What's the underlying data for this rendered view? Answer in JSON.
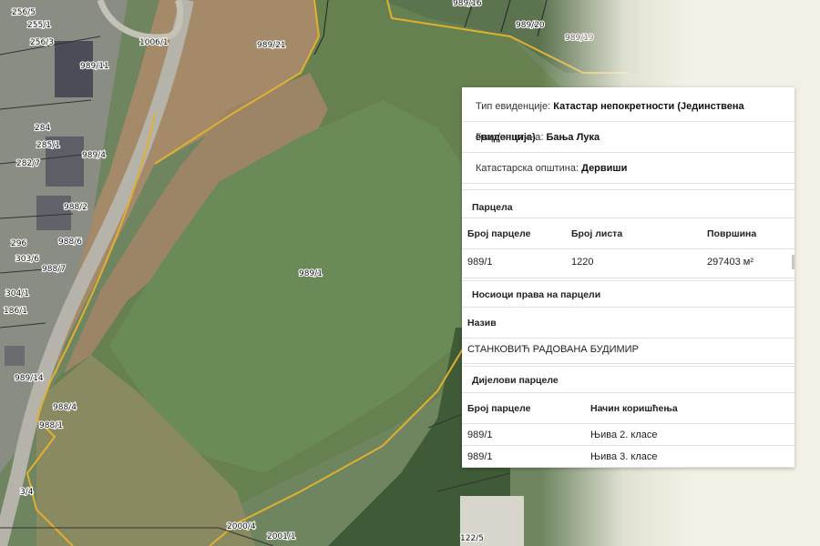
{
  "map": {
    "parcel_labels": [
      "256/5",
      "255/1",
      "256/3",
      "1006/1",
      "989/21",
      "989/16",
      "989/20",
      "989/19",
      "989/11",
      "989/4",
      "284",
      "285/1",
      "282/7",
      "988/2",
      "296",
      "988/6",
      "303/6",
      "988/7",
      "304/1",
      "186/1",
      "989/1",
      "989/14",
      "988/4",
      "988/1",
      "3/4",
      "2000/4",
      "2001/1",
      "122/5"
    ]
  },
  "panel": {
    "info": [
      {
        "key": "Тип евиденције: ",
        "value": "Катастар непокретности (Јединствена евиденција)"
      },
      {
        "key": "Град/општина: ",
        "value": "Бања Лука"
      },
      {
        "key": "Катастарска општина: ",
        "value": "Дервиши"
      }
    ],
    "parcel_section": {
      "title": "Парцела",
      "headers": [
        "Број парцеле",
        "Број листа",
        "Површина"
      ],
      "row": {
        "parcel_no": "989/1",
        "sheet_no": "1220",
        "area": "297403 м²"
      }
    },
    "holders_section": {
      "title": "Носиоци права на парцели",
      "header": "Назив",
      "name": "СТАНКОВИЋ РАДОВАНА БУДИМИР"
    },
    "parts_section": {
      "title": "Дијелови парцеле",
      "headers": [
        "Број парцеле",
        "Начин коришћења"
      ],
      "rows": [
        {
          "parcel_no": "989/1",
          "usage": "Њива 2. класе"
        },
        {
          "parcel_no": "989/1",
          "usage": "Њива 3. класе"
        }
      ]
    }
  }
}
